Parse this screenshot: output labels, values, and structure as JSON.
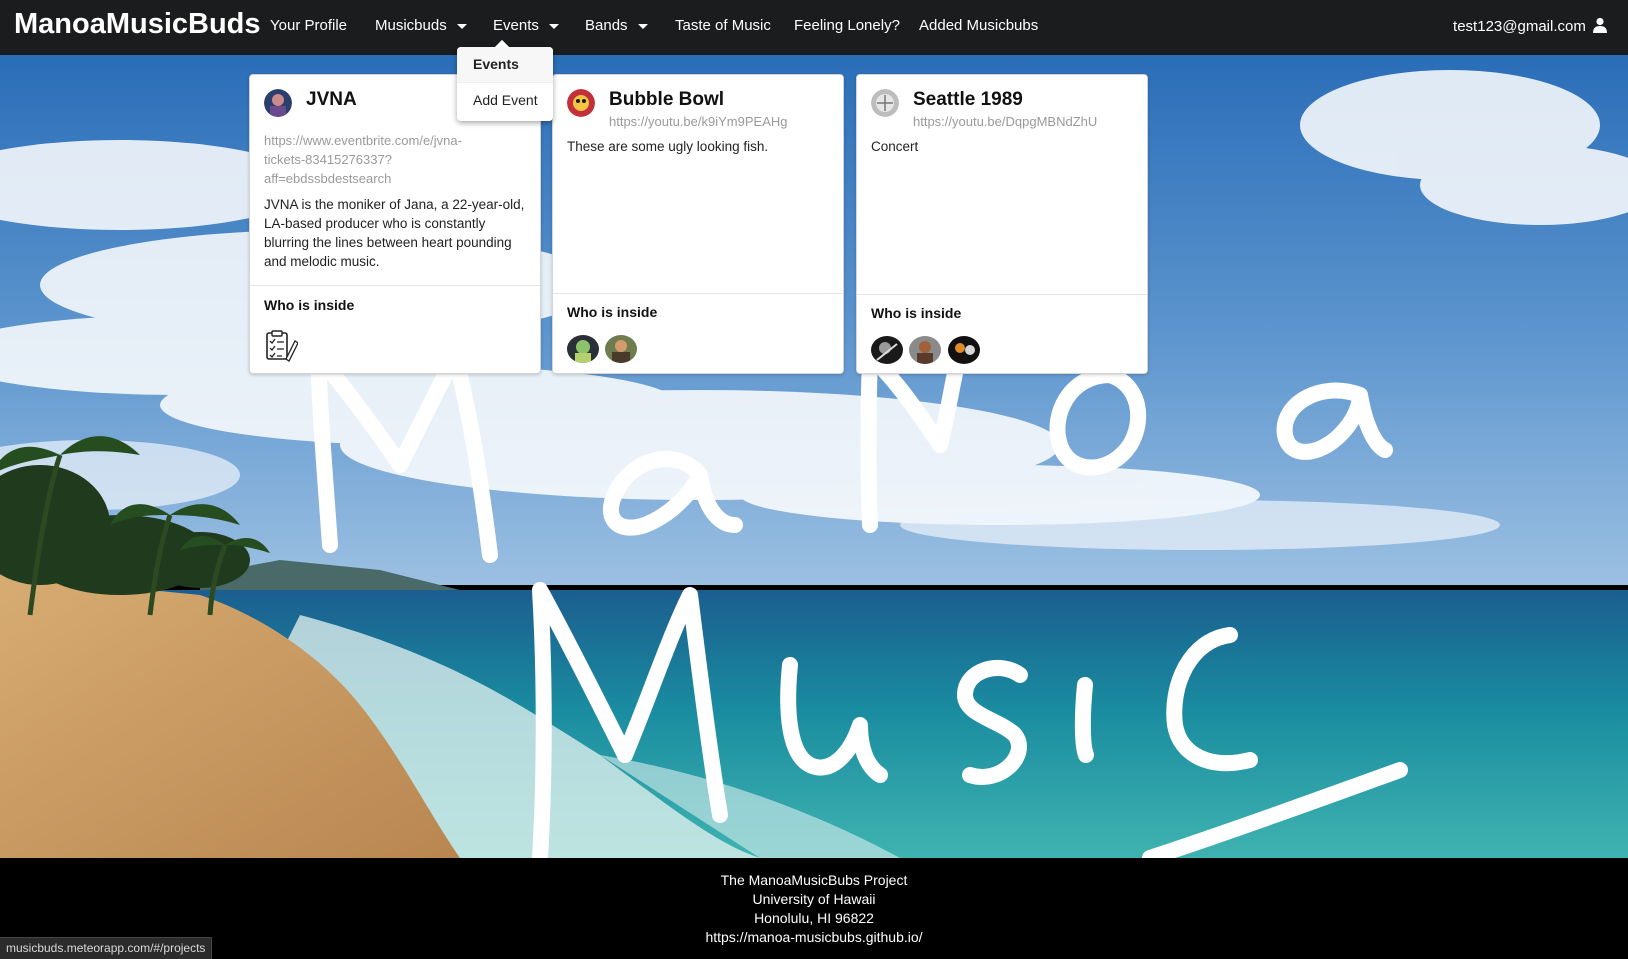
{
  "navbar": {
    "brand": "ManoaMusicBuds",
    "items": [
      {
        "label": "Your Profile"
      },
      {
        "label": "Musicbuds"
      },
      {
        "label": "Events"
      },
      {
        "label": "Bands"
      },
      {
        "label": "Taste of Music"
      },
      {
        "label": "Feeling Lonely?"
      },
      {
        "label": "Added Musicbubs"
      }
    ],
    "user_email": "test123@gmail.com",
    "user_icon": "user-icon"
  },
  "dropdown": {
    "items": [
      {
        "label": "Events",
        "active": true
      },
      {
        "label": "Add Event",
        "active": false
      }
    ]
  },
  "background": {
    "overlay_text": [
      "ManoA",
      "Music"
    ]
  },
  "cards": [
    {
      "title": "JVNA",
      "url": "https://www.eventbrite.com/e/jvna-tickets-83415276337?aff=ebdssbdestsearch",
      "url_lines": [
        "https://www.eventbrite.com/e/jvna-",
        "tickets-83415276337?",
        "aff=ebdssbdestsearch"
      ],
      "description_lines": [
        "JVNA is the moniker of Jana, a 22-year-old,",
        "LA-based producer who is constantly",
        "blurring the lines between heart pounding",
        "and melodic music."
      ],
      "who_inside_label": "Who is inside",
      "members_icon": "checklist-icon"
    },
    {
      "title": "Bubble Bowl",
      "url": "https://youtu.be/k9iYm9PEAHg",
      "description": "These are some ugly looking fish.",
      "who_inside_label": "Who is inside"
    },
    {
      "title": "Seattle 1989",
      "url": "https://youtu.be/DqpgMBNdZhU",
      "description": "Concert",
      "who_inside_label": "Who is inside"
    }
  ],
  "footer": {
    "lines": [
      "The ManoaMusicBubs Project",
      "University of Hawaii",
      "Honolulu, HI 96822",
      "https://manoa-musicbubs.github.io/"
    ]
  },
  "statusbar": {
    "url": "musicbuds.meteorapp.com/#/projects"
  },
  "colors": {
    "navbar_bg": "#1b1c1d",
    "footer_bg": "#000000",
    "sky": "#3b7bc2",
    "ocean": "#1e8fa3",
    "sand": "#c89a62"
  }
}
